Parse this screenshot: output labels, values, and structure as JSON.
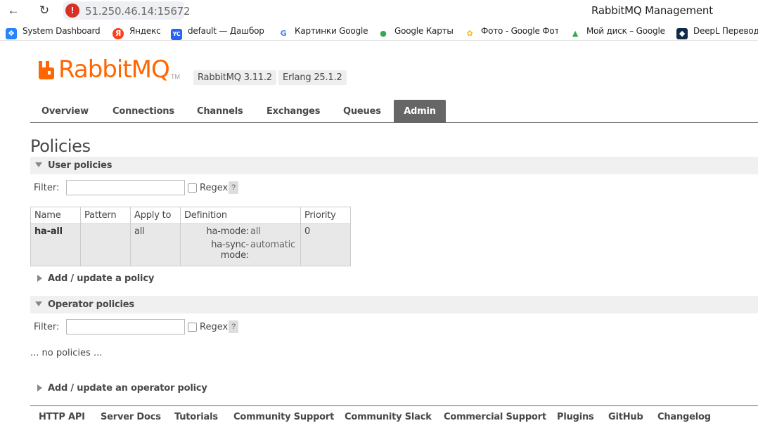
{
  "browser": {
    "address": "51.250.46.14:15672",
    "window_title": "RabbitMQ Management",
    "bookmarks": [
      {
        "label": "System Dashboard",
        "icon": "jira-icon"
      },
      {
        "label": "Яндекс",
        "icon": "yandex-icon"
      },
      {
        "label": "default — Дашбор",
        "icon": "yc-icon"
      },
      {
        "label": "Картинки Google",
        "icon": "google-icon"
      },
      {
        "label": "Google Карты",
        "icon": "maps-icon"
      },
      {
        "label": "Фото - Google Фот",
        "icon": "photos-icon"
      },
      {
        "label": "Мой диск – Google",
        "icon": "drive-icon"
      },
      {
        "label": "DeepL Перевод",
        "icon": "deepl-icon"
      }
    ]
  },
  "header": {
    "logo_text": "Rabbit",
    "logo_text2": "MQ",
    "logo_tm": "TM",
    "version": "RabbitMQ 3.11.2",
    "erlang": "Erlang 25.1.2"
  },
  "tabs": [
    {
      "label": "Overview",
      "active": false
    },
    {
      "label": "Connections",
      "active": false
    },
    {
      "label": "Channels",
      "active": false
    },
    {
      "label": "Exchanges",
      "active": false
    },
    {
      "label": "Queues",
      "active": false
    },
    {
      "label": "Admin",
      "active": true
    }
  ],
  "page_title": "Policies",
  "user_policies": {
    "title": "User policies",
    "filter_label": "Filter:",
    "filter_value": "",
    "regex_label": "Regex",
    "help": "?",
    "columns": [
      "Name",
      "Pattern",
      "Apply to",
      "Definition",
      "Priority"
    ],
    "rows": [
      {
        "name": "ha-all",
        "pattern": "",
        "apply_to": "all",
        "definition": [
          {
            "key": "ha-mode:",
            "value": "all"
          },
          {
            "key": "ha-sync-mode:",
            "value": "automatic"
          }
        ],
        "priority": "0"
      }
    ]
  },
  "add_policy": "Add / update a policy",
  "operator_policies": {
    "title": "Operator policies",
    "filter_label": "Filter:",
    "filter_value": "",
    "regex_label": "Regex",
    "help": "?",
    "empty_text": "... no policies ..."
  },
  "add_operator_policy": "Add / update an operator policy",
  "footer": [
    "HTTP API",
    "Server Docs",
    "Tutorials",
    "Community Support",
    "Community Slack",
    "Commercial Support",
    "Plugins",
    "GitHub",
    "Changelog"
  ],
  "colors": {
    "accent": "#ff6600",
    "tab_active": "#666666"
  }
}
